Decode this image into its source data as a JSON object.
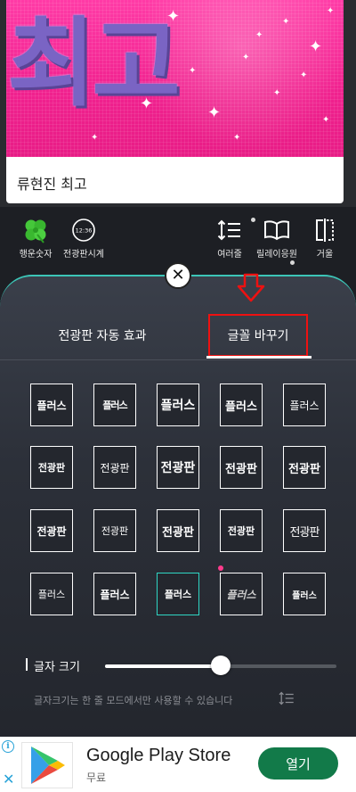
{
  "preview": {
    "board_text": "l최고",
    "caption": "류현진 최고"
  },
  "toolbar": {
    "items": [
      {
        "label": "행운숫자",
        "icon": "clover-icon"
      },
      {
        "label": "전광판시계",
        "icon": "clock-icon",
        "clock_text": "12:36"
      },
      {
        "label": "여러줄",
        "icon": "multiline-icon"
      },
      {
        "label": "릴레이응원",
        "icon": "book-icon"
      },
      {
        "label": "거울",
        "icon": "mirror-icon"
      }
    ]
  },
  "panel": {
    "tabs": [
      {
        "label": "전광판 자동 효과",
        "selected": false
      },
      {
        "label": "글꼴 바꾸기",
        "selected": true
      }
    ],
    "font_rows": [
      [
        "플러스",
        "플러스",
        "플러스",
        "플러스",
        "플러스"
      ],
      [
        "전광판",
        "전광판",
        "전광판",
        "전광판",
        "전광판"
      ],
      [
        "전광판",
        "전광판",
        "전광판",
        "전광판",
        "전광판"
      ],
      [
        "플러스",
        "플러스",
        "플러스",
        "플러스",
        "플러스"
      ]
    ],
    "selected_font": {
      "row": 3,
      "col": 2
    },
    "size_label": "글자 크기",
    "size_value_fraction": 0.5,
    "hint": "글자크기는 한 줄 모드에서만 사용할 수 있습니다"
  },
  "ad": {
    "title": "Google Play Store",
    "subtitle": "무료",
    "button_label": "열기",
    "info_icon_text": "i",
    "close_icon_text": "✕"
  },
  "colors": {
    "accent": "#2fd6c4",
    "highlight_red": "#e11111",
    "board_pink": "#f0218e",
    "ad_button": "#127a49"
  }
}
